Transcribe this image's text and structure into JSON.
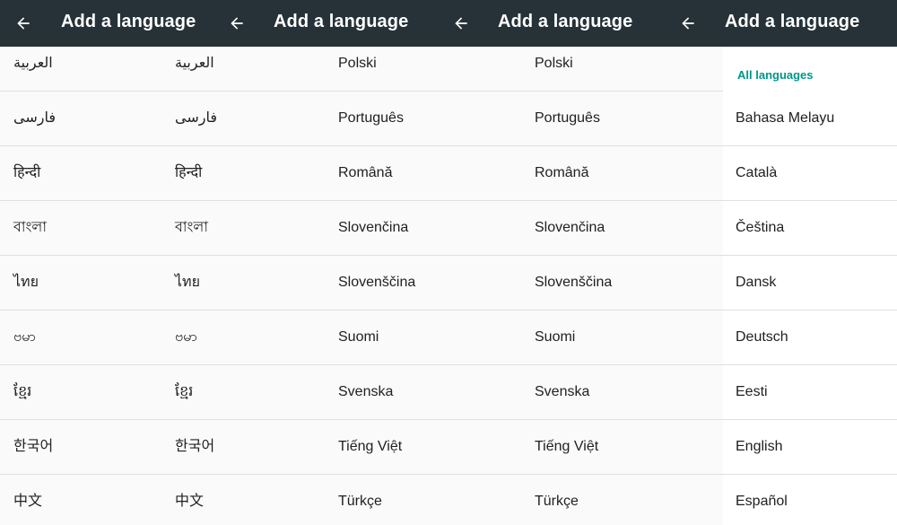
{
  "appbar": {
    "title": "Add a language",
    "back_icon": "arrow-left-icon"
  },
  "colors": {
    "appbar_bg": "#263238",
    "accent": "#009688",
    "text": "#212121",
    "divider": "#e0e0e0"
  },
  "panel_1": {
    "items": [
      "العربية",
      "فارسی",
      "हिन्दी",
      "বাংলা",
      "ไทย",
      "ဗမာ",
      "ខ្មែរ",
      "한국어",
      "中文"
    ]
  },
  "panel_2": {
    "items": [
      "العربية",
      "فارسی",
      "हिन्दी",
      "বাংলা",
      "ไทย",
      "ဗမာ",
      "ខ្មែរ",
      "한국어",
      "中文"
    ]
  },
  "panel_3": {
    "items": [
      "Polski",
      "Português",
      "Română",
      "Slovenčina",
      "Slovenščina",
      "Suomi",
      "Svenska",
      "Tiếng Việt",
      "Türkçe"
    ]
  },
  "panel_4": {
    "items": [
      "Polski",
      "Português",
      "Română",
      "Slovenčina",
      "Slovenščina",
      "Suomi",
      "Svenska",
      "Tiếng Việt",
      "Türkçe"
    ]
  },
  "panel_5": {
    "section_header": "All languages",
    "items": [
      "Bahasa Melayu",
      "Català",
      "Čeština",
      "Dansk",
      "Deutsch",
      "Eesti",
      "English",
      "Español"
    ]
  }
}
